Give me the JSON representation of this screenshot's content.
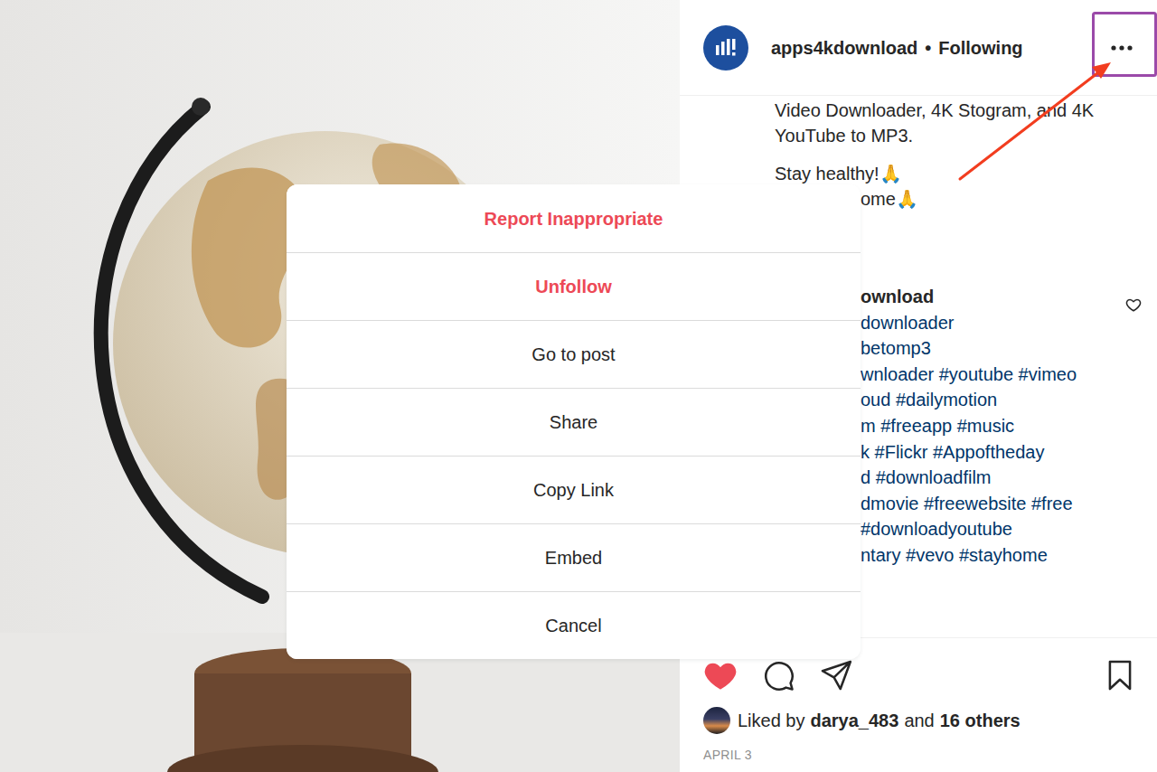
{
  "header": {
    "username": "apps4kdownload",
    "separator": "•",
    "follow_status": "Following"
  },
  "caption": {
    "lines": [
      {
        "text": "Video Downloader, 4K Stogram, and 4K",
        "kind": "line"
      },
      {
        "text": "YouTube to MP3.",
        "kind": "line"
      },
      {
        "text": "Stay healthy!🙏",
        "kind": "line"
      },
      {
        "text": "ome🙏",
        "kind": "fragment"
      }
    ]
  },
  "comment": {
    "author": "ownload",
    "liked": false,
    "lines": [
      "downloader",
      "betomp3",
      "wnloader #youtube #vimeo",
      "oud #dailymotion",
      "m #freeapp #music",
      "k #Flickr #Appoftheday",
      "d #downloadfilm",
      "dmovie #freewebsite #free",
      "#downloadyoutube",
      "ntary #vevo #stayhome"
    ]
  },
  "actions": {
    "liked": true,
    "saved": false
  },
  "likes": {
    "parts": [
      {
        "text": "Liked by",
        "kind": "plain"
      },
      {
        "text": "darya_483",
        "kind": "strong"
      },
      {
        "text": "and",
        "kind": "plain"
      },
      {
        "text": "16 others",
        "kind": "strong"
      }
    ]
  },
  "date": "APRIL 3",
  "menu": {
    "items": [
      {
        "label": "Report Inappropriate",
        "kind": "danger"
      },
      {
        "label": "Unfollow",
        "kind": "danger"
      },
      {
        "label": "Go to post",
        "kind": "normal"
      },
      {
        "label": "Share",
        "kind": "normal"
      },
      {
        "label": "Copy Link",
        "kind": "normal"
      },
      {
        "label": "Embed",
        "kind": "normal"
      },
      {
        "label": "Cancel",
        "kind": "normal"
      }
    ]
  }
}
